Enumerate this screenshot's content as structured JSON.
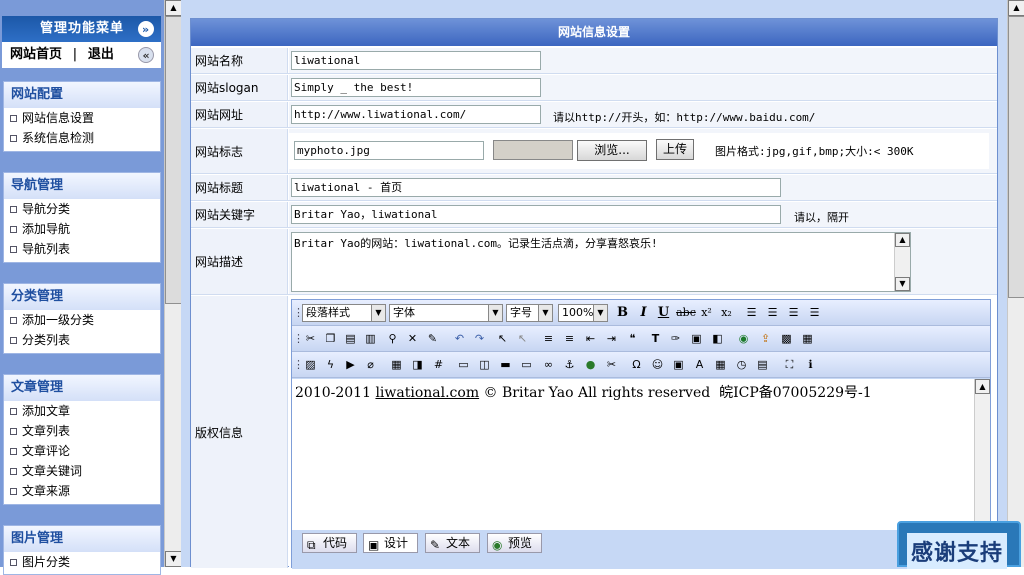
{
  "sidebar": {
    "title": "管理功能菜单",
    "home_label": "网站首页",
    "sep": "|",
    "logout_label": "退出",
    "groups": [
      {
        "title": "网站配置",
        "items": [
          "网站信息设置",
          "系统信息检测"
        ]
      },
      {
        "title": "导航管理",
        "items": [
          "导航分类",
          "添加导航",
          "导航列表"
        ]
      },
      {
        "title": "分类管理",
        "items": [
          "添加一级分类",
          "分类列表"
        ]
      },
      {
        "title": "文章管理",
        "items": [
          "添加文章",
          "文章列表",
          "文章评论",
          "文章关键词",
          "文章来源"
        ]
      },
      {
        "title": "图片管理",
        "items": [
          "图片分类"
        ]
      }
    ]
  },
  "panel": {
    "title": "网站信息设置"
  },
  "form": {
    "name": {
      "label": "网站名称",
      "value": "liwational"
    },
    "slogan": {
      "label": "网站slogan",
      "value": "Simply _ the best!"
    },
    "url": {
      "label": "网站网址",
      "value": "http://www.liwational.com/",
      "hint": "请以http://开头，如：http://www.baidu.com/"
    },
    "logo": {
      "label": "网站标志",
      "value": "myphoto.jpg",
      "browse": "浏览...",
      "upload": "上传",
      "hint": "图片格式:jpg,gif,bmp;大小:< 300K"
    },
    "title": {
      "label": "网站标题",
      "value": "liwational - 首页"
    },
    "keywords": {
      "label": "网站关键字",
      "value": "Britar Yao，liwational",
      "hint": "请以，隔开"
    },
    "desc": {
      "label": "网站描述",
      "value": "Britar Yao的网站：liwational.com。记录生活点滴，分享喜怒哀乐!"
    },
    "copyright": {
      "label": "版权信息"
    }
  },
  "editor": {
    "paragraph_style": "段落样式",
    "font": "字体",
    "font_size": "字号",
    "zoom": "100%",
    "content_prefix": "2010-2011 ",
    "content_link": "liwational.com",
    "content_suffix": " © Britar Yao All rights reserved  皖ICP备07005229号-1",
    "modes": [
      "代码",
      "设计",
      "文本",
      "预览"
    ]
  },
  "badge": {
    "text": "感谢支持"
  }
}
